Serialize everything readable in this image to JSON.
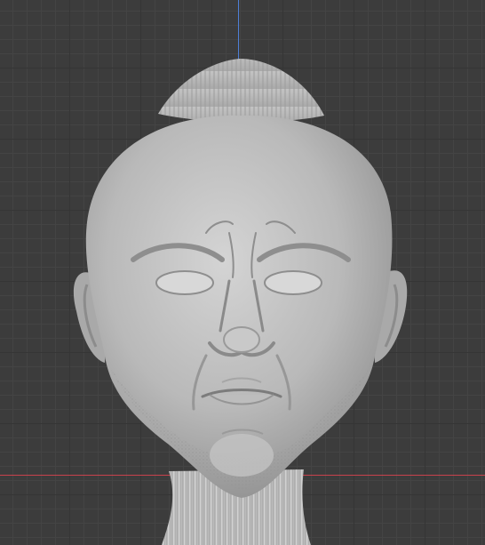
{
  "viewport": {
    "background_color": "#3c3c3c",
    "grid_minor_color": "#444444",
    "grid_major_color": "#353535",
    "axis_y_color": "#4e7fd6",
    "axis_x_color": "#c8424d",
    "model_color": "#b9b9b9"
  },
  "model": {
    "object": "sculpted-head"
  }
}
